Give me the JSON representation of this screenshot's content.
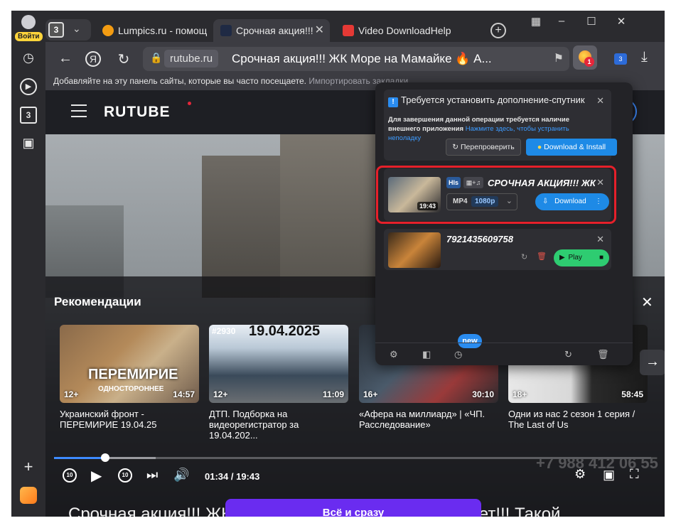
{
  "rail": {
    "login_label": "Войти",
    "tab_count": "3"
  },
  "tabs": {
    "count": "3",
    "items": [
      {
        "label": "Lumpics.ru - помощ",
        "color": "#f39c12"
      },
      {
        "label": "Срочная акция!!!",
        "color": "#1f2a44"
      },
      {
        "label": "Video DownloadHelp",
        "color": "#e53935"
      }
    ]
  },
  "address": {
    "domain": "rutube.ru",
    "title": "Срочная акция!!! ЖК Море на Мамайке 🔥 А...",
    "ext_badge": "1",
    "ext2_badge": "3"
  },
  "bookmarks": {
    "text": "Добавляйте на эту панель сайты, которые вы часто посещаете.",
    "import": "Импортировать закладки"
  },
  "rutube": {
    "logo": "RUTUBE",
    "recs_title": "Рекомендации",
    "cards": [
      {
        "title": "Украинский фронт - ПЕРЕМИРИЕ 19.04.25",
        "age": "12+",
        "duration": "14:57",
        "caption": "ПЕРЕМИРИЕ",
        "subcaption": "ОДНОСТОРОННЕЕ"
      },
      {
        "title": "ДТП. Подборка на видеорегистратор за 19.04.202...",
        "age": "12+",
        "duration": "11:09",
        "number": "#2930",
        "date": "19.04.2025"
      },
      {
        "title": "«Афера на миллиард» | «ЧП. Расследование»",
        "age": "16+",
        "duration": "30:10"
      },
      {
        "title": "Одни из нас 2 сезон 1 серия / The Last of Us",
        "age": "18+",
        "duration": "58:45"
      }
    ],
    "player": {
      "time": "01:34 / 19:43",
      "progress": 0.086,
      "buffered": 0.17,
      "watermark": "+7 988 412 06 55"
    },
    "video_title": "Срочная акция!!! ЖК Море на Мамайке 🔥 Долгов нет!!! Такой",
    "cta": "Всё и сразу"
  },
  "popup": {
    "notice_title": "Требуется установить дополнение-спутник",
    "notice_body": "Для завершения данной операции требуется наличие внешнего приложения",
    "notice_link": "Нажмите здесь, чтобы устранить неполадку",
    "recheck": "Перепроверить",
    "install": "Download & Install",
    "item1": {
      "title": "СРОЧНАЯ АКЦИЯ!!! ЖК ...",
      "tag": "Hls",
      "format": "MP4",
      "quality": "1080p",
      "duration": "19:43",
      "download": "Download"
    },
    "item2": {
      "title": "7921435609758",
      "play": "Play"
    },
    "new_badge": "new"
  }
}
